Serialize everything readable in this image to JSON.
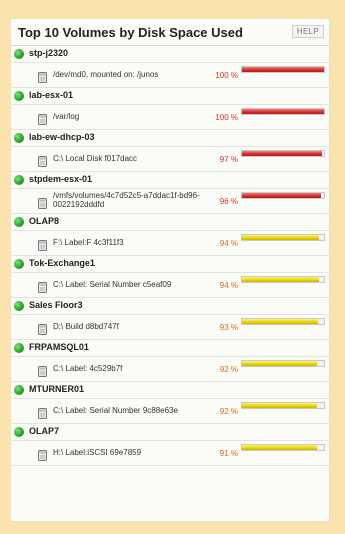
{
  "widget": {
    "title": "Top 10 Volumes by Disk Space Used",
    "help_label": "HELP"
  },
  "colors": {
    "critical": "#d62828",
    "warning": "#ead400",
    "status_up": "#2aa52a"
  },
  "rows": [
    {
      "node": "stp-j2320",
      "volume": "/dev/md0, mounted on: /junos",
      "percent": "100 %",
      "used": 1.0,
      "level": "red"
    },
    {
      "node": "lab-esx-01",
      "volume": "/var/log",
      "percent": "100 %",
      "used": 1.0,
      "level": "red"
    },
    {
      "node": "lab-ew-dhcp-03",
      "volume": "C:\\ Local Disk f017dacc",
      "percent": "97 %",
      "used": 0.97,
      "level": "red"
    },
    {
      "node": "stpdem-esx-01",
      "volume": "/vmfs/volumes/4c7d52c5-a7ddac1f-bd96-0022192dddfd",
      "percent": "96 %",
      "used": 0.96,
      "level": "red"
    },
    {
      "node": "OLAP8",
      "volume": "F:\\ Label:F 4c3f11f3",
      "percent": "94 %",
      "used": 0.94,
      "level": "yellow"
    },
    {
      "node": "Tok-Exchange1",
      "volume": "C:\\ Label: Serial Number c5eaf09",
      "percent": "94 %",
      "used": 0.94,
      "level": "yellow"
    },
    {
      "node": "Sales Floor3",
      "volume": "D:\\ Build d8bd747f",
      "percent": "93 %",
      "used": 0.93,
      "level": "yellow"
    },
    {
      "node": "FRPAMSQL01",
      "volume": "C:\\ Label: 4c529b7f",
      "percent": "92 %",
      "used": 0.92,
      "level": "yellow"
    },
    {
      "node": "MTURNER01",
      "volume": "C:\\ Label: Serial Number 9c88e63e",
      "percent": "92 %",
      "used": 0.92,
      "level": "yellow"
    },
    {
      "node": "OLAP7",
      "volume": "H:\\ Label:iSCSI 69e7859",
      "percent": "91 %",
      "used": 0.91,
      "level": "yellow"
    }
  ]
}
